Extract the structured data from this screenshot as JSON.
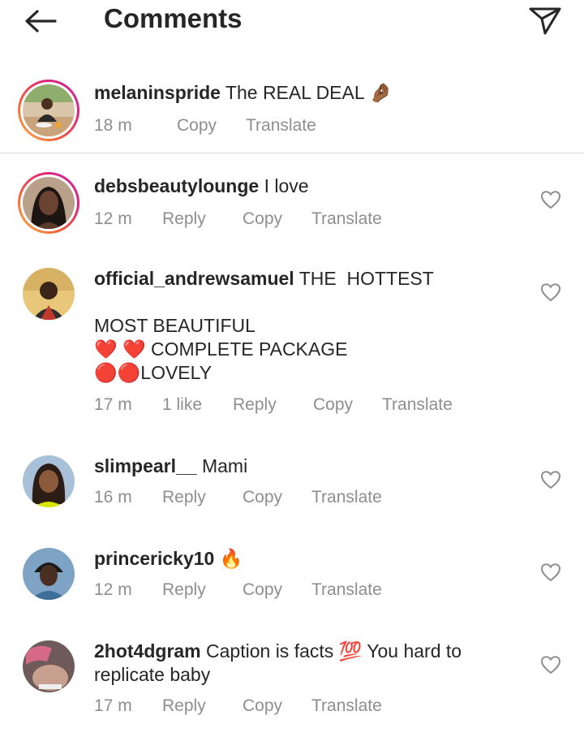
{
  "header": {
    "title": "Comments"
  },
  "comments": [
    {
      "username": "melaninspride",
      "text": "The REAL DEAL 🤌🏾",
      "time": "18 m",
      "actions": [
        "Copy",
        "Translate"
      ]
    },
    {
      "username": "debsbeautylounge",
      "text": "I love",
      "time": "12 m",
      "actions": [
        "Reply",
        "Copy",
        "Translate"
      ]
    },
    {
      "username": "official_andrewsamuel",
      "text": "THE  HOTTEST\n\nMOST BEAUTIFUL\n❤️ ❤️ COMPLETE PACKAGE\n🔴🔴LOVELY",
      "time": "17 m",
      "likes": "1 like",
      "actions": [
        "Reply",
        "Copy",
        "Translate"
      ]
    },
    {
      "username": "slimpearl__",
      "text": "Mami",
      "time": "16 m",
      "actions": [
        "Reply",
        "Copy",
        "Translate"
      ]
    },
    {
      "username": "princericky10",
      "text": "🔥",
      "time": "12 m",
      "actions": [
        "Reply",
        "Copy",
        "Translate"
      ]
    },
    {
      "username": "2hot4dgram",
      "text": "Caption is facts 💯 You hard to replicate baby",
      "time": "17 m",
      "actions": [
        "Reply",
        "Copy",
        "Translate"
      ]
    }
  ]
}
